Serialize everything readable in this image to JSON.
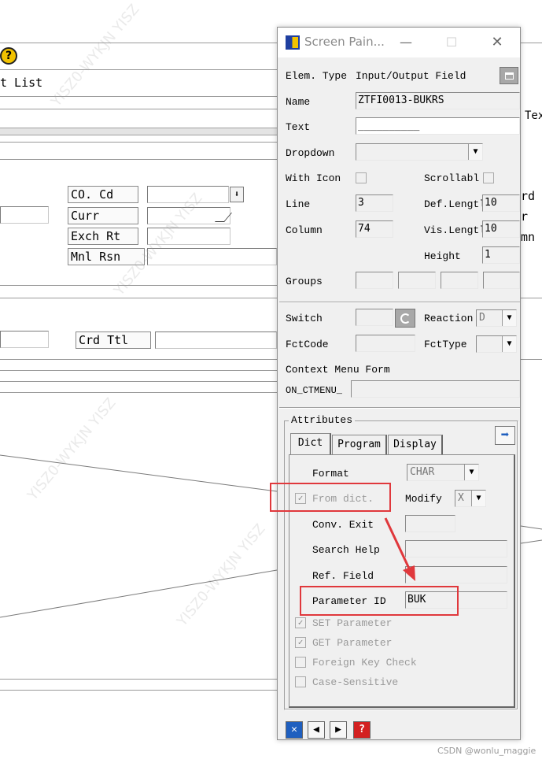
{
  "background": {
    "menu_item": "t List",
    "labels": {
      "co_cd": "CO. Cd",
      "curr": "Curr",
      "exch_rt": "Exch Rt",
      "mnl_rsn": "Mnl Rsn",
      "crd_ttl": "Crd Ttl",
      "rd": "rd",
      "r": "r",
      "mn": "mn",
      "tex": "Tex"
    }
  },
  "dialog": {
    "title": "Screen Pain...",
    "fields": {
      "elem_type_label": "Elem. Type",
      "elem_type_value": "Input/Output Field",
      "name_label": "Name",
      "name_value": "ZTFI0013-BUKRS",
      "text_label": "Text",
      "text_value": "__________",
      "dropdown_label": "Dropdown",
      "with_icon_label": "With Icon",
      "scrollable_label": "Scrollabl",
      "line_label": "Line",
      "line_value": "3",
      "def_length_label": "Def.Lengtl",
      "def_length_value": "10",
      "column_label": "Column",
      "column_value": "74",
      "vis_length_label": "Vis.Lengtl",
      "vis_length_value": "10",
      "height_label": "Height",
      "height_value": "1",
      "groups_label": "Groups",
      "switch_label": "Switch",
      "reaction_label": "Reaction",
      "reaction_value": "D",
      "fctcode_label": "FctCode",
      "fcttype_label": "FctType",
      "context_menu_label": "Context Menu Form",
      "context_menu_prefix": "ON_CTMENU_"
    },
    "attributes": {
      "group_label": "Attributes",
      "tabs": [
        "Dict",
        "Program",
        "Display"
      ],
      "format_label": "Format",
      "format_value": "CHAR",
      "from_dict_label": "From dict.",
      "modify_label": "Modify",
      "modify_value": "X",
      "conv_exit_label": "Conv. Exit",
      "search_help_label": "Search Help",
      "ref_field_label": "Ref. Field",
      "parameter_id_label": "Parameter ID",
      "parameter_id_value": "BUK",
      "set_parameter_label": "SET Parameter",
      "get_parameter_label": "GET Parameter",
      "foreign_key_label": "Foreign Key Check",
      "case_sensitive_label": "Case-Sensitive"
    }
  },
  "watermark": "CSDN @wonlu_maggie",
  "colors": {
    "highlight": "#e0383c",
    "accent_blue": "#1f5fbf"
  }
}
